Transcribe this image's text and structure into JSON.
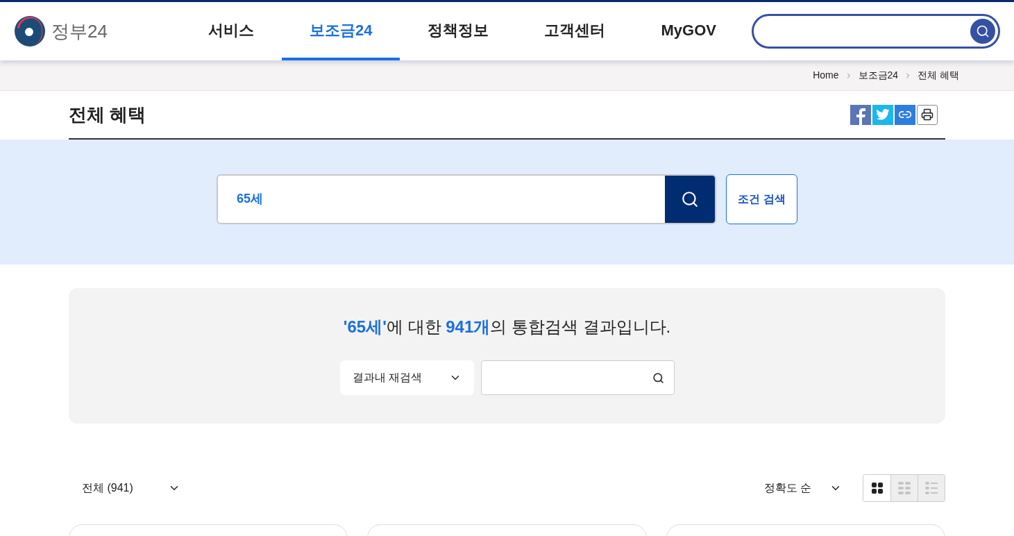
{
  "header": {
    "logo_text": "정부24",
    "nav": [
      {
        "label": "서비스",
        "selected": false
      },
      {
        "label": "보조금24",
        "selected": true
      },
      {
        "label": "정책정보",
        "selected": false
      },
      {
        "label": "고객센터",
        "selected": false
      },
      {
        "label": "MyGOV",
        "selected": false
      }
    ]
  },
  "breadcrumb": [
    "Home",
    "보조금24",
    "전체 혜택"
  ],
  "page_title": "전체 혜택",
  "search": {
    "value": "65세",
    "condition_button": "조건 검색"
  },
  "result_summary": "**'65세'**에 대한 **941개**의 통합검색 결과입니다.",
  "refine": {
    "scope": "결과내 재검색"
  },
  "filter": {
    "category": "전체 (941)",
    "sort": "정확도 순",
    "views": [
      {
        "kind": "grid",
        "selected": true
      },
      {
        "kind": "compact",
        "selected": false
      },
      {
        "kind": "list",
        "selected": false
      }
    ]
  }
}
